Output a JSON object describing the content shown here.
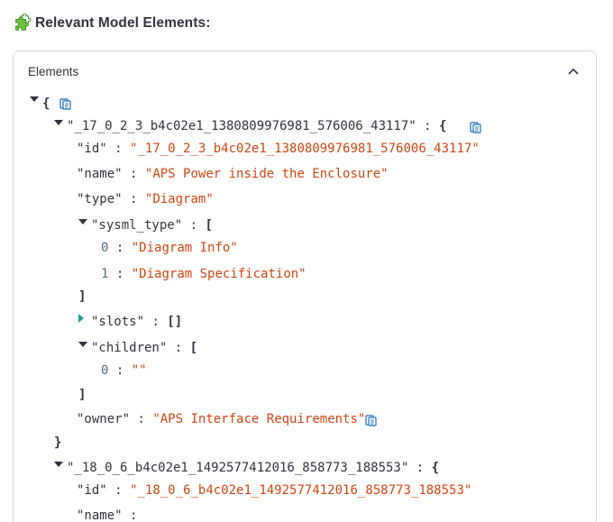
{
  "header": {
    "title": "Relevant Model Elements:",
    "icon": "puzzle-icon"
  },
  "expander": {
    "label": "Elements",
    "expanded": true
  },
  "json": {
    "root_open": "{",
    "root_close": "}",
    "colon": ":",
    "obj_open": "{",
    "arr_open": "[",
    "arr_close": "]",
    "empty_arr": "[]",
    "elem1": {
      "key": "\"_17_0_2_3_b4c02e1_1380809976981_576006_43117\"",
      "id_key": "\"id\"",
      "id_val": "\"_17_0_2_3_b4c02e1_1380809976981_576006_43117\"",
      "name_key": "\"name\"",
      "name_val": "\"APS Power inside the Enclosure\"",
      "type_key": "\"type\"",
      "type_val": "\"Diagram\"",
      "sysml_key": "\"sysml_type\"",
      "sysml_items": [
        {
          "index": "0",
          "value": "\"Diagram Info\""
        },
        {
          "index": "1",
          "value": "\"Diagram Specification\""
        }
      ],
      "slots_key": "\"slots\"",
      "children_key": "\"children\"",
      "children_items": [
        {
          "index": "0",
          "value": "\"\""
        }
      ],
      "owner_key": "\"owner\"",
      "owner_val": "\"APS Interface Requirements\""
    },
    "elem2": {
      "key": "\"_18_0_6_b4c02e1_1492577412016_858773_188553\"",
      "id_key": "\"id\"",
      "id_val": "\"_18_0_6_b4c02e1_1492577412016_858773_188553\"",
      "name_key": "\"name\""
    }
  },
  "colors": {
    "string": "#d14515",
    "index": "#5a6b82",
    "copy_icon": "#3b82c4",
    "triangle": "#31333f",
    "collapsed_triangle": "#2a9d8f"
  }
}
